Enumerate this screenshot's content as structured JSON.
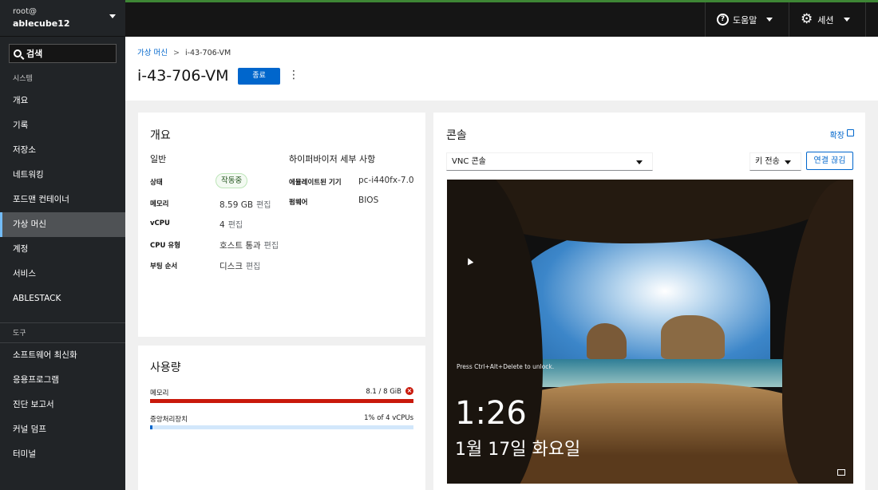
{
  "host": {
    "user": "root@",
    "hostname": "ablecube12"
  },
  "sidebar": {
    "search": "검색",
    "system_header": "시스템",
    "system_items": [
      "개요",
      "기록",
      "저장소",
      "네트워킹",
      "포드맨 컨테이너",
      "가상 머신",
      "계정",
      "서비스",
      "ABLESTACK"
    ],
    "active": "가상 머신",
    "tools_header": "도구",
    "tools_items": [
      "소프트웨어 최신화",
      "응용프로그램",
      "진단 보고서",
      "커널 덤프",
      "터미널"
    ]
  },
  "topbar": {
    "help": "도움말",
    "session": "세션"
  },
  "breadcrumb": {
    "parent": "가상 머신",
    "current": "i-43-706-VM"
  },
  "vm": {
    "name": "i-43-706-VM",
    "stop_label": "종료"
  },
  "overview": {
    "title": "개요",
    "general_title": "일반",
    "hypervisor_title": "하이퍼바이저 세부 사항",
    "state_label": "상태",
    "state_value": "작동중",
    "memory_label": "메모리",
    "memory_value": "8.59 GB",
    "vcpu_label": "vCPU",
    "vcpu_value": "4",
    "cpu_type_label": "CPU 유형",
    "cpu_type_value": "호스트 통과",
    "boot_label": "부팅 순서",
    "boot_value": "디스크",
    "edit": "편집",
    "emulated_label": "에뮬레이트된 기기",
    "emulated_value": "pc-i440fx-7.0",
    "firmware_label": "펌웨어",
    "firmware_value": "BIOS"
  },
  "usage": {
    "title": "사용량",
    "memory_label": "메모리",
    "memory_value": "8.1 / 8 GiB",
    "memory_fraction": 1.0,
    "cpu_label": "중앙처리장치",
    "cpu_value": "1% of 4 vCPUs",
    "cpu_fraction": 0.01,
    "danger_color": "#c9190b",
    "normal_color": "#06c"
  },
  "console": {
    "title": "콘솔",
    "expand": "확장",
    "type": "VNC 콘솔",
    "send_key": "키 전송",
    "disconnect": "연결 끊김",
    "lock_hint": "Press Ctrl+Alt+Delete to unlock.",
    "time": "1:26",
    "date": "1월 17일 화요일"
  }
}
